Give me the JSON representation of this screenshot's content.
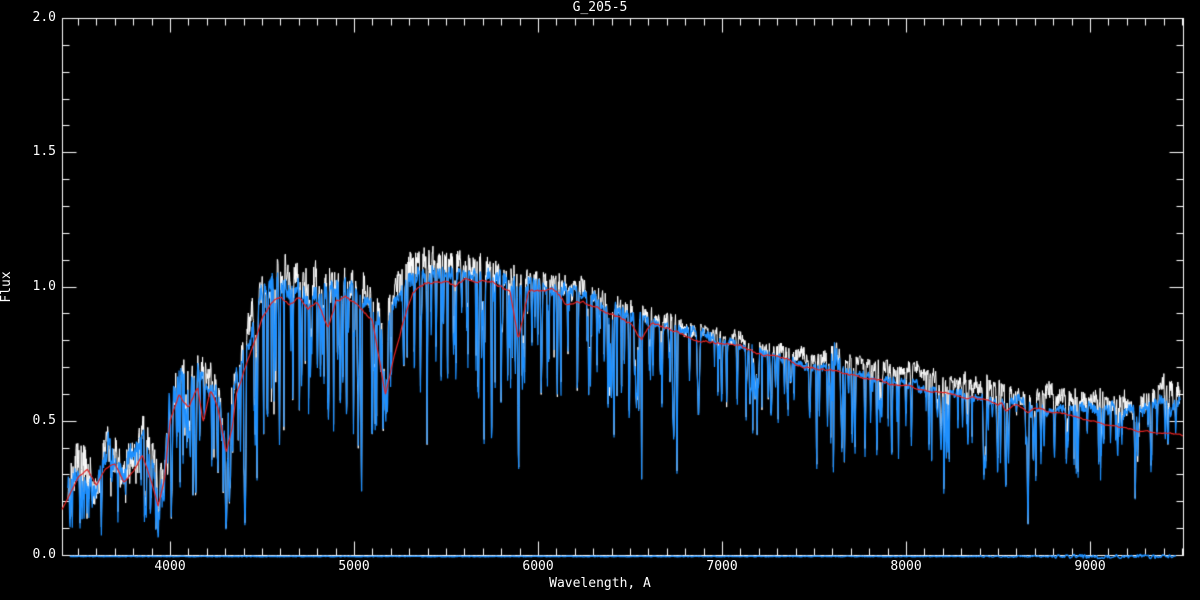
{
  "window": {
    "background": "#000000",
    "foreground": "#ffffff"
  },
  "chart_data": {
    "type": "line",
    "title": "G_205-5",
    "xlabel": "Wavelength, A",
    "ylabel": "Flux",
    "xlim": [
      3413,
      9505
    ],
    "ylim": [
      0.0,
      2.0
    ],
    "grid": false,
    "legend": null,
    "x_major_ticks": [
      4000,
      5000,
      6000,
      7000,
      8000,
      9000
    ],
    "x_tick_labels": [
      "4000",
      "5000",
      "6000",
      "7000",
      "8000",
      "9000"
    ],
    "x_minor_step": 100,
    "y_major_ticks": [
      0.0,
      0.5,
      1.0,
      1.5,
      2.0
    ],
    "y_tick_labels": [
      "0.0",
      "0.5",
      "1.0",
      "1.5",
      "2.0"
    ],
    "y_minor_step": 0.1,
    "colors": {
      "observed": "#1e90ff",
      "unsmoothed": "#ffffff",
      "template": "#e32222",
      "axes": "#ffffff"
    },
    "series": [
      {
        "name": "observed-spectrum",
        "color": "#1e90ff",
        "style": "noisy-line"
      },
      {
        "name": "unsmoothed-spectrum",
        "color": "#ffffff",
        "style": "noisy-line-behind"
      },
      {
        "name": "template-fit",
        "color": "#e32222",
        "style": "smooth-line"
      },
      {
        "name": "zero-level",
        "color": "#1e90ff",
        "style": "flat-line",
        "flux": 0.0,
        "x_range": [
          3455,
          9470
        ]
      }
    ],
    "observed_continuum": [
      [
        3413,
        0.22
      ],
      [
        3450,
        0.27
      ],
      [
        3500,
        0.31
      ],
      [
        3540,
        0.34
      ],
      [
        3580,
        0.26
      ],
      [
        3620,
        0.31
      ],
      [
        3660,
        0.36
      ],
      [
        3700,
        0.33
      ],
      [
        3740,
        0.28
      ],
      [
        3780,
        0.33
      ],
      [
        3820,
        0.38
      ],
      [
        3860,
        0.38
      ],
      [
        3900,
        0.3
      ],
      [
        3940,
        0.24
      ],
      [
        3970,
        0.3
      ],
      [
        4000,
        0.58
      ],
      [
        4050,
        0.66
      ],
      [
        4100,
        0.63
      ],
      [
        4150,
        0.68
      ],
      [
        4200,
        0.65
      ],
      [
        4250,
        0.61
      ],
      [
        4300,
        0.5
      ],
      [
        4350,
        0.62
      ],
      [
        4400,
        0.75
      ],
      [
        4450,
        0.86
      ],
      [
        4500,
        0.96
      ],
      [
        4550,
        1.0
      ],
      [
        4600,
        1.01
      ],
      [
        4650,
        0.99
      ],
      [
        4700,
        1.0
      ],
      [
        4750,
        0.98
      ],
      [
        4800,
        0.99
      ],
      [
        4850,
        0.97
      ],
      [
        4900,
        0.99
      ],
      [
        4950,
        1.01
      ],
      [
        5000,
        0.99
      ],
      [
        5050,
        0.96
      ],
      [
        5100,
        0.93
      ],
      [
        5150,
        0.87
      ],
      [
        5200,
        0.9
      ],
      [
        5250,
        0.98
      ],
      [
        5300,
        1.03
      ],
      [
        5350,
        1.05
      ],
      [
        5400,
        1.04
      ],
      [
        5450,
        1.05
      ],
      [
        5500,
        1.06
      ],
      [
        5550,
        1.05
      ],
      [
        5600,
        1.05
      ],
      [
        5650,
        1.04
      ],
      [
        5700,
        1.05
      ],
      [
        5750,
        1.04
      ],
      [
        5800,
        1.03
      ],
      [
        5850,
        1.01
      ],
      [
        5900,
        1.0
      ],
      [
        5950,
        1.01
      ],
      [
        6000,
        1.01
      ],
      [
        6100,
        0.99
      ],
      [
        6200,
        0.97
      ],
      [
        6300,
        0.95
      ],
      [
        6400,
        0.92
      ],
      [
        6500,
        0.89
      ],
      [
        6600,
        0.87
      ],
      [
        6700,
        0.85
      ],
      [
        6800,
        0.83
      ],
      [
        6900,
        0.81
      ],
      [
        7000,
        0.8
      ],
      [
        7100,
        0.78
      ],
      [
        7200,
        0.76
      ],
      [
        7300,
        0.74
      ],
      [
        7400,
        0.72
      ],
      [
        7500,
        0.71
      ],
      [
        7600,
        0.7
      ],
      [
        7700,
        0.68
      ],
      [
        7800,
        0.66
      ],
      [
        7900,
        0.65
      ],
      [
        8000,
        0.64
      ],
      [
        8100,
        0.62
      ],
      [
        8200,
        0.61
      ],
      [
        8300,
        0.6
      ],
      [
        8400,
        0.59
      ],
      [
        8500,
        0.58
      ],
      [
        8600,
        0.57
      ],
      [
        8700,
        0.56
      ],
      [
        8800,
        0.55
      ],
      [
        8900,
        0.54
      ],
      [
        9000,
        0.54
      ],
      [
        9100,
        0.53
      ],
      [
        9200,
        0.53
      ],
      [
        9300,
        0.54
      ],
      [
        9400,
        0.56
      ],
      [
        9505,
        0.58
      ]
    ],
    "template_fit": [
      [
        3413,
        0.17
      ],
      [
        3450,
        0.22
      ],
      [
        3500,
        0.29
      ],
      [
        3550,
        0.32
      ],
      [
        3600,
        0.26
      ],
      [
        3650,
        0.32
      ],
      [
        3700,
        0.34
      ],
      [
        3750,
        0.27
      ],
      [
        3800,
        0.31
      ],
      [
        3850,
        0.37
      ],
      [
        3900,
        0.27
      ],
      [
        3935,
        0.18
      ],
      [
        3970,
        0.28
      ],
      [
        4000,
        0.5
      ],
      [
        4050,
        0.6
      ],
      [
        4100,
        0.55
      ],
      [
        4150,
        0.63
      ],
      [
        4180,
        0.5
      ],
      [
        4220,
        0.62
      ],
      [
        4260,
        0.55
      ],
      [
        4305,
        0.38
      ],
      [
        4340,
        0.48
      ],
      [
        4360,
        0.6
      ],
      [
        4400,
        0.68
      ],
      [
        4450,
        0.78
      ],
      [
        4500,
        0.88
      ],
      [
        4550,
        0.93
      ],
      [
        4600,
        0.95
      ],
      [
        4650,
        0.93
      ],
      [
        4700,
        0.95
      ],
      [
        4750,
        0.91
      ],
      [
        4800,
        0.94
      ],
      [
        4861,
        0.84
      ],
      [
        4900,
        0.94
      ],
      [
        4950,
        0.96
      ],
      [
        5000,
        0.94
      ],
      [
        5050,
        0.91
      ],
      [
        5100,
        0.88
      ],
      [
        5170,
        0.6
      ],
      [
        5210,
        0.72
      ],
      [
        5270,
        0.88
      ],
      [
        5320,
        0.99
      ],
      [
        5400,
        1.0
      ],
      [
        5450,
        1.01
      ],
      [
        5500,
        1.02
      ],
      [
        5550,
        1.01
      ],
      [
        5600,
        1.02
      ],
      [
        5700,
        1.01
      ],
      [
        5800,
        1.0
      ],
      [
        5850,
        0.97
      ],
      [
        5893,
        0.8
      ],
      [
        5950,
        0.98
      ],
      [
        6000,
        0.99
      ],
      [
        6100,
        0.97
      ],
      [
        6150,
        0.93
      ],
      [
        6200,
        0.95
      ],
      [
        6300,
        0.93
      ],
      [
        6400,
        0.9
      ],
      [
        6500,
        0.87
      ],
      [
        6563,
        0.8
      ],
      [
        6620,
        0.86
      ],
      [
        6700,
        0.84
      ],
      [
        6800,
        0.82
      ],
      [
        6870,
        0.79
      ],
      [
        6950,
        0.8
      ],
      [
        7000,
        0.79
      ],
      [
        7100,
        0.77
      ],
      [
        7200,
        0.74
      ],
      [
        7300,
        0.73
      ],
      [
        7400,
        0.71
      ],
      [
        7500,
        0.7
      ],
      [
        7600,
        0.69
      ],
      [
        7700,
        0.67
      ],
      [
        7800,
        0.66
      ],
      [
        7900,
        0.64
      ],
      [
        8000,
        0.63
      ],
      [
        8100,
        0.61
      ],
      [
        8200,
        0.6
      ],
      [
        8300,
        0.59
      ],
      [
        8400,
        0.58
      ],
      [
        8498,
        0.55
      ],
      [
        8520,
        0.56
      ],
      [
        8542,
        0.53
      ],
      [
        8600,
        0.56
      ],
      [
        8662,
        0.53
      ],
      [
        8700,
        0.55
      ],
      [
        8800,
        0.53
      ],
      [
        8900,
        0.52
      ],
      [
        9000,
        0.5
      ],
      [
        9100,
        0.48
      ],
      [
        9200,
        0.47
      ],
      [
        9300,
        0.46
      ],
      [
        9400,
        0.45
      ],
      [
        9505,
        0.44
      ]
    ],
    "absorption_lines": [
      [
        3933,
        0.5,
        5
      ],
      [
        3968,
        0.45,
        5
      ],
      [
        4045,
        0.3,
        4
      ],
      [
        4102,
        0.4,
        5
      ],
      [
        4144,
        0.3,
        4
      ],
      [
        4227,
        0.45,
        4
      ],
      [
        4305,
        0.35,
        14
      ],
      [
        4340,
        0.45,
        5
      ],
      [
        4383,
        0.45,
        4
      ],
      [
        4457,
        0.3,
        4
      ],
      [
        4531,
        0.3,
        4
      ],
      [
        4668,
        0.35,
        4
      ],
      [
        4861,
        0.5,
        5
      ],
      [
        4920,
        0.3,
        4
      ],
      [
        4957,
        0.35,
        4
      ],
      [
        5110,
        0.3,
        5
      ],
      [
        5170,
        0.35,
        18
      ],
      [
        5270,
        0.35,
        8
      ],
      [
        5328,
        0.3,
        4
      ],
      [
        5711,
        0.25,
        5
      ],
      [
        5893,
        0.62,
        7
      ],
      [
        6122,
        0.3,
        4
      ],
      [
        6162,
        0.3,
        4
      ],
      [
        6280,
        0.25,
        8
      ],
      [
        6360,
        0.25,
        5
      ],
      [
        6494,
        0.35,
        5
      ],
      [
        6563,
        0.68,
        5
      ],
      [
        6717,
        0.25,
        4
      ],
      [
        6872,
        0.4,
        12
      ],
      [
        7180,
        0.25,
        12
      ],
      [
        7270,
        0.2,
        6
      ],
      [
        7665,
        0.25,
        6
      ],
      [
        8190,
        0.4,
        10
      ],
      [
        8227,
        0.25,
        5
      ],
      [
        8434,
        0.3,
        5
      ],
      [
        8498,
        0.5,
        7
      ],
      [
        8542,
        0.65,
        8
      ],
      [
        8662,
        0.6,
        8
      ],
      [
        8750,
        0.3,
        5
      ],
      [
        8806,
        0.3,
        5
      ],
      [
        8880,
        0.3,
        5
      ],
      [
        9061,
        0.3,
        6
      ],
      [
        9150,
        0.35,
        6
      ],
      [
        9245,
        0.45,
        8
      ],
      [
        9408,
        0.3,
        6
      ]
    ],
    "emission_bump_7600": [
      [
        7588,
        0.08,
        5
      ],
      [
        7598,
        0.12,
        6
      ],
      [
        7610,
        0.1,
        5
      ],
      [
        7622,
        0.07,
        5
      ],
      [
        7638,
        0.05,
        5
      ],
      [
        7655,
        0.04,
        4
      ]
    ],
    "line_forest": [
      {
        "range": [
          3413,
          4000
        ],
        "per_100A": 5,
        "depth": [
          0.25,
          0.75
        ],
        "width": [
          2,
          6
        ]
      },
      {
        "range": [
          4000,
          4500
        ],
        "per_100A": 8,
        "depth": [
          0.2,
          0.7
        ],
        "width": [
          2,
          7
        ]
      },
      {
        "range": [
          4500,
          5200
        ],
        "per_100A": 8,
        "depth": [
          0.15,
          0.6
        ],
        "width": [
          2,
          6
        ]
      },
      {
        "range": [
          5200,
          6000
        ],
        "per_100A": 6,
        "depth": [
          0.1,
          0.55
        ],
        "width": [
          2,
          6
        ]
      },
      {
        "range": [
          6000,
          6600
        ],
        "per_100A": 6,
        "depth": [
          0.1,
          0.5
        ],
        "width": [
          2,
          6
        ]
      },
      {
        "range": [
          6600,
          7600
        ],
        "per_100A": 5,
        "depth": [
          0.08,
          0.45
        ],
        "width": [
          2,
          7
        ]
      },
      {
        "range": [
          7600,
          8400
        ],
        "per_100A": 5,
        "depth": [
          0.08,
          0.5
        ],
        "width": [
          2,
          7
        ]
      },
      {
        "range": [
          8400,
          9500
        ],
        "per_100A": 4,
        "depth": [
          0.08,
          0.5
        ],
        "width": [
          2,
          8
        ]
      }
    ],
    "noise_amp_slow": [
      [
        3413,
        0.2
      ],
      [
        3900,
        0.18
      ],
      [
        3980,
        0.08
      ],
      [
        4100,
        0.05
      ],
      [
        4500,
        0.035
      ],
      [
        5000,
        0.03
      ],
      [
        5500,
        0.025
      ],
      [
        6000,
        0.02
      ],
      [
        7000,
        0.018
      ],
      [
        7600,
        0.02
      ],
      [
        8000,
        0.025
      ],
      [
        8700,
        0.04
      ],
      [
        9100,
        0.05
      ],
      [
        9505,
        0.055
      ]
    ],
    "noise_amp_fast": [
      [
        3413,
        0.12
      ],
      [
        3900,
        0.1
      ],
      [
        4000,
        0.045
      ],
      [
        4500,
        0.035
      ],
      [
        5000,
        0.03
      ],
      [
        6000,
        0.022
      ],
      [
        7000,
        0.018
      ],
      [
        8000,
        0.02
      ],
      [
        8800,
        0.03
      ],
      [
        9505,
        0.04
      ]
    ],
    "unsmoothed_offset": [
      [
        3413,
        0.02
      ],
      [
        4500,
        0.03
      ],
      [
        5500,
        0.03
      ],
      [
        6500,
        0.02
      ],
      [
        7400,
        0.02
      ],
      [
        7800,
        0.045
      ],
      [
        8400,
        0.045
      ],
      [
        8700,
        0.035
      ],
      [
        9000,
        0.04
      ],
      [
        9505,
        0.05
      ]
    ],
    "data_x_range": [
      3445,
      9489
    ]
  }
}
